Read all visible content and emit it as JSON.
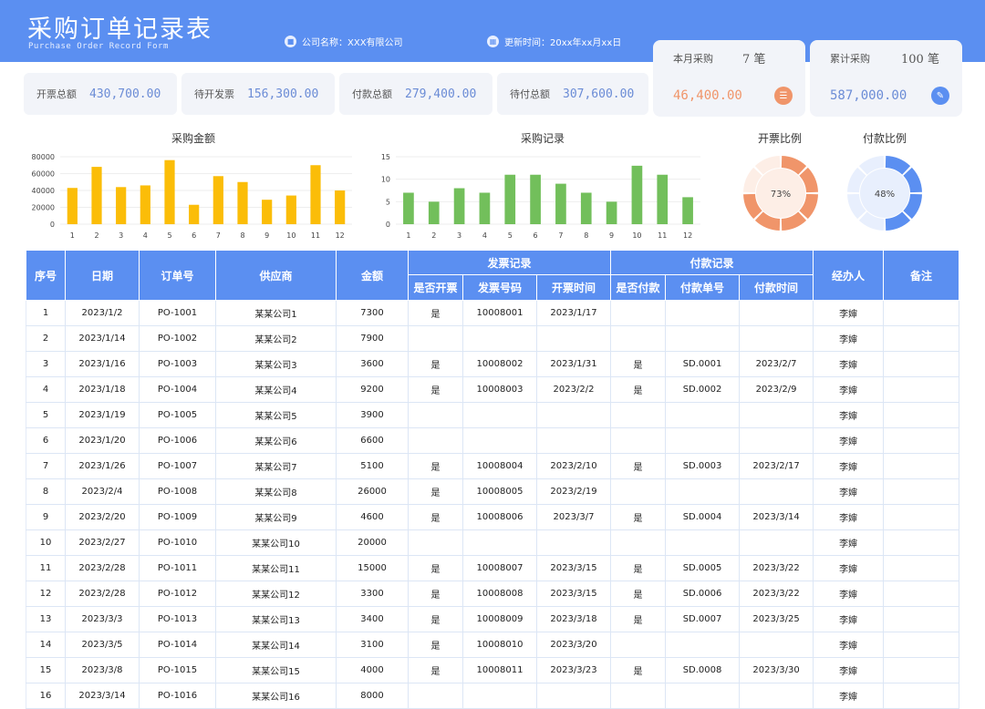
{
  "header": {
    "title": "采购订单记录表",
    "subtitle": "Purchase Order Record Form",
    "company": "公司名称：XXX有限公司",
    "updated": "更新时间：20xx年xx月xx日"
  },
  "kpis": [
    {
      "label": "开票总额",
      "value": "430,700.00"
    },
    {
      "label": "待开发票",
      "value": "156,300.00"
    },
    {
      "label": "付款总额",
      "value": "279,400.00"
    },
    {
      "label": "待付总额",
      "value": "307,600.00"
    }
  ],
  "monthly": {
    "label": "本月采购",
    "count": "7 笔",
    "amount": "46,400.00",
    "color": "#f0956a"
  },
  "cumulative": {
    "label": "累计采购",
    "count": "100 笔",
    "amount": "587,000.00",
    "color": "#5b8ff1"
  },
  "chart_data": [
    {
      "type": "bar",
      "title": "采购金额",
      "categories": [
        "1",
        "2",
        "3",
        "4",
        "5",
        "6",
        "7",
        "8",
        "9",
        "10",
        "11",
        "12"
      ],
      "values": [
        43000,
        68000,
        44000,
        46000,
        76000,
        23000,
        57000,
        50000,
        29000,
        34000,
        70000,
        40000
      ],
      "yticks": [
        0,
        20000,
        40000,
        60000,
        80000
      ],
      "ylim": [
        0,
        80000
      ],
      "color": "#fbbd08"
    },
    {
      "type": "bar",
      "title": "采购记录",
      "categories": [
        "1",
        "2",
        "3",
        "4",
        "5",
        "6",
        "7",
        "8",
        "9",
        "10",
        "11",
        "12"
      ],
      "values": [
        7,
        5,
        8,
        7,
        11,
        11,
        9,
        7,
        5,
        13,
        11,
        6
      ],
      "yticks": [
        0,
        5,
        10,
        15
      ],
      "ylim": [
        0,
        15
      ],
      "color": "#72bf5b"
    },
    {
      "type": "pie",
      "title": "开票比例",
      "percent": 73,
      "label": "73%",
      "color": "#f0956a",
      "track": "#fdeee6"
    },
    {
      "type": "pie",
      "title": "付款比例",
      "percent": 48,
      "label": "48%",
      "color": "#5b8ff1",
      "track": "#e8effd"
    }
  ],
  "table": {
    "headers": {
      "seq": "序号",
      "date": "日期",
      "order": "订单号",
      "supplier": "供应商",
      "amount": "金额",
      "invoice_group": "发票记录",
      "invoiced": "是否开票",
      "invoice_no": "发票号码",
      "invoice_time": "开票时间",
      "payment_group": "付款记录",
      "paid": "是否付款",
      "pay_no": "付款单号",
      "pay_time": "付款时间",
      "handler": "经办人",
      "note": "备注"
    },
    "rows": [
      [
        "1",
        "2023/1/2",
        "PO-1001",
        "某某公司1",
        "7300",
        "是",
        "10008001",
        "2023/1/17",
        "",
        "",
        "",
        "李婶",
        ""
      ],
      [
        "2",
        "2023/1/14",
        "PO-1002",
        "某某公司2",
        "7900",
        "",
        "",
        "",
        "",
        "",
        "",
        "李婶",
        ""
      ],
      [
        "3",
        "2023/1/16",
        "PO-1003",
        "某某公司3",
        "3600",
        "是",
        "10008002",
        "2023/1/31",
        "是",
        "SD.0001",
        "2023/2/7",
        "李婶",
        ""
      ],
      [
        "4",
        "2023/1/18",
        "PO-1004",
        "某某公司4",
        "9200",
        "是",
        "10008003",
        "2023/2/2",
        "是",
        "SD.0002",
        "2023/2/9",
        "李婶",
        ""
      ],
      [
        "5",
        "2023/1/19",
        "PO-1005",
        "某某公司5",
        "3900",
        "",
        "",
        "",
        "",
        "",
        "",
        "李婶",
        ""
      ],
      [
        "6",
        "2023/1/20",
        "PO-1006",
        "某某公司6",
        "6600",
        "",
        "",
        "",
        "",
        "",
        "",
        "李婶",
        ""
      ],
      [
        "7",
        "2023/1/26",
        "PO-1007",
        "某某公司7",
        "5100",
        "是",
        "10008004",
        "2023/2/10",
        "是",
        "SD.0003",
        "2023/2/17",
        "李婶",
        ""
      ],
      [
        "8",
        "2023/2/4",
        "PO-1008",
        "某某公司8",
        "26000",
        "是",
        "10008005",
        "2023/2/19",
        "",
        "",
        "",
        "李婶",
        ""
      ],
      [
        "9",
        "2023/2/20",
        "PO-1009",
        "某某公司9",
        "4600",
        "是",
        "10008006",
        "2023/3/7",
        "是",
        "SD.0004",
        "2023/3/14",
        "李婶",
        ""
      ],
      [
        "10",
        "2023/2/27",
        "PO-1010",
        "某某公司10",
        "20000",
        "",
        "",
        "",
        "",
        "",
        "",
        "李婶",
        ""
      ],
      [
        "11",
        "2023/2/28",
        "PO-1011",
        "某某公司11",
        "15000",
        "是",
        "10008007",
        "2023/3/15",
        "是",
        "SD.0005",
        "2023/3/22",
        "李婶",
        ""
      ],
      [
        "12",
        "2023/2/28",
        "PO-1012",
        "某某公司12",
        "3300",
        "是",
        "10008008",
        "2023/3/15",
        "是",
        "SD.0006",
        "2023/3/22",
        "李婶",
        ""
      ],
      [
        "13",
        "2023/3/3",
        "PO-1013",
        "某某公司13",
        "3400",
        "是",
        "10008009",
        "2023/3/18",
        "是",
        "SD.0007",
        "2023/3/25",
        "李婶",
        ""
      ],
      [
        "14",
        "2023/3/5",
        "PO-1014",
        "某某公司14",
        "3100",
        "是",
        "10008010",
        "2023/3/20",
        "",
        "",
        "",
        "李婶",
        ""
      ],
      [
        "15",
        "2023/3/8",
        "PO-1015",
        "某某公司15",
        "4000",
        "是",
        "10008011",
        "2023/3/23",
        "是",
        "SD.0008",
        "2023/3/30",
        "李婶",
        ""
      ],
      [
        "16",
        "2023/3/14",
        "PO-1016",
        "某某公司16",
        "8000",
        "",
        "",
        "",
        "",
        "",
        "",
        "李婶",
        ""
      ]
    ]
  }
}
